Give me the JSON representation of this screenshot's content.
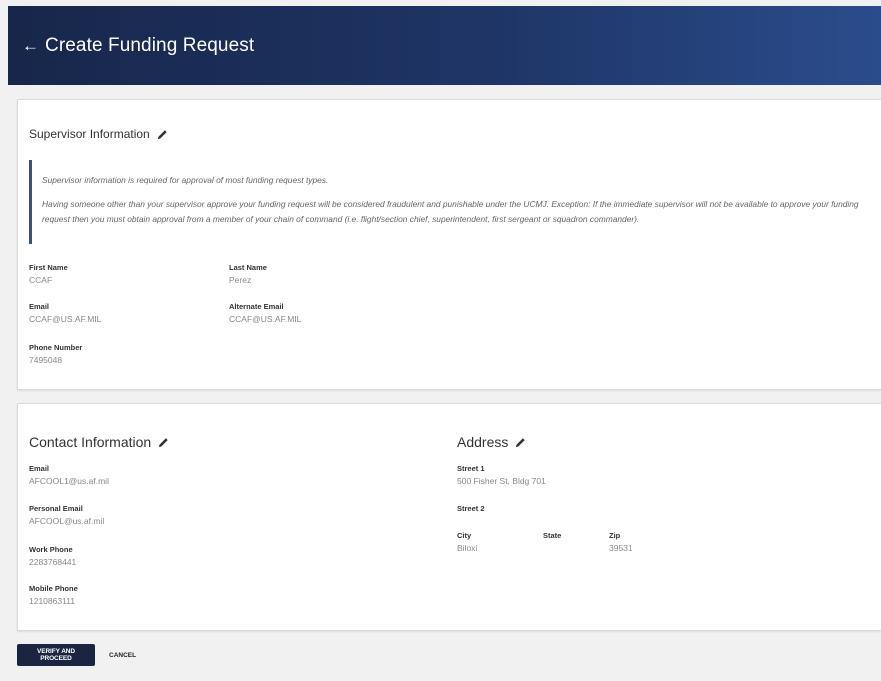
{
  "header": {
    "back_icon": "arrow-left-icon",
    "title": "Create Funding Request"
  },
  "supervisor": {
    "title": "Supervisor Information",
    "edit_icon": "pencil-icon",
    "notice_line1": "Supervisor information is required for approval of most funding request types.",
    "notice_line2": "Having someone other than your supervisor approve your funding request will be considered fraudulent and punishable under the UCMJ. Exception: If the immediate supervisor will not be available to approve your funding request then you must obtain approval from a member of your chain of command (i.e. flight/section chief, superintendent, first sergeant or squadron commander).",
    "fields": {
      "first_name": {
        "label": "First Name",
        "value": "CCAF"
      },
      "last_name": {
        "label": "Last Name",
        "value": "Perez"
      },
      "email": {
        "label": "Email",
        "value": "CCAF@US.AF.MIL"
      },
      "alternate_email": {
        "label": "Alternate Email",
        "value": "CCAF@US.AF.MIL"
      },
      "phone_number": {
        "label": "Phone Number",
        "value": "7495048"
      }
    }
  },
  "contact": {
    "title": "Contact Information",
    "edit_icon": "pencil-icon",
    "fields": {
      "email": {
        "label": "Email",
        "value": "AFCOOL1@us.af.mil"
      },
      "personal_email": {
        "label": "Personal Email",
        "value": "AFCOOL@us.af.mil"
      },
      "work_phone": {
        "label": "Work Phone",
        "value": "2283768441"
      },
      "mobile_phone": {
        "label": "Mobile Phone",
        "value": "1210863111"
      }
    }
  },
  "address": {
    "title": "Address",
    "edit_icon": "pencil-icon",
    "fields": {
      "street1": {
        "label": "Street 1",
        "value": "500 Fisher St, Bldg 701"
      },
      "street2": {
        "label": "Street 2",
        "value": ""
      },
      "city": {
        "label": "City",
        "value": "Biloxi"
      },
      "state": {
        "label": "State",
        "value": ""
      },
      "zip": {
        "label": "Zip",
        "value": "39531"
      }
    }
  },
  "actions": {
    "verify_label": "VERIFY AND PROCEED",
    "cancel_label": "CANCEL"
  },
  "colors": {
    "header_dark": "#18264a",
    "header_light": "#2b4c8c",
    "accent_bar": "#3a4e8c",
    "primary_button": "#1b2441"
  }
}
